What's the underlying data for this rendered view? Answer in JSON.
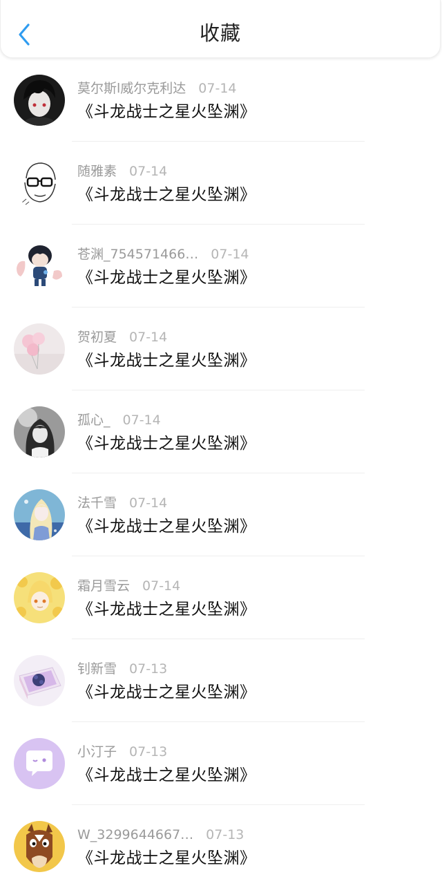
{
  "header": {
    "title": "收藏",
    "back_icon": "chevron-left-icon",
    "accent_color": "#2f9cf0"
  },
  "items": [
    {
      "user": "莫尔斯l威尔克利达",
      "date": "07-14",
      "book": "《斗龙战士之星火坠渊》",
      "avatar": "dark-haired-boy-avatar"
    },
    {
      "user": "随雅素",
      "date": "07-14",
      "book": "《斗龙战士之星火坠渊》",
      "avatar": "glasses-sketch-avatar"
    },
    {
      "user": "苍渊_754571466…",
      "date": "07-14",
      "book": "《斗龙战士之星火坠渊》",
      "avatar": "chibi-boy-avatar"
    },
    {
      "user": "贺初夏",
      "date": "07-14",
      "book": "《斗龙战士之星火坠渊》",
      "avatar": "pink-balloons-avatar"
    },
    {
      "user": "孤心_",
      "date": "07-14",
      "book": "《斗龙战士之星火坠渊》",
      "avatar": "gray-girl-avatar"
    },
    {
      "user": "法千雪",
      "date": "07-14",
      "book": "《斗龙战士之星火坠渊》",
      "avatar": "elf-girl-avatar"
    },
    {
      "user": "霜月雪云",
      "date": "07-14",
      "book": "《斗龙战士之星火坠渊》",
      "avatar": "yellow-flower-girl-avatar"
    },
    {
      "user": "钊新雪",
      "date": "07-13",
      "book": "《斗龙战士之星火坠渊》",
      "avatar": "flower-box-avatar"
    },
    {
      "user": "小汀子",
      "date": "07-13",
      "book": "《斗龙战士之星火坠渊》",
      "avatar": "purple-chat-bubble-avatar"
    },
    {
      "user": "W_3299644667…",
      "date": "07-13",
      "book": "《斗龙战士之星火坠渊》",
      "avatar": "cartoon-horse-avatar"
    }
  ]
}
